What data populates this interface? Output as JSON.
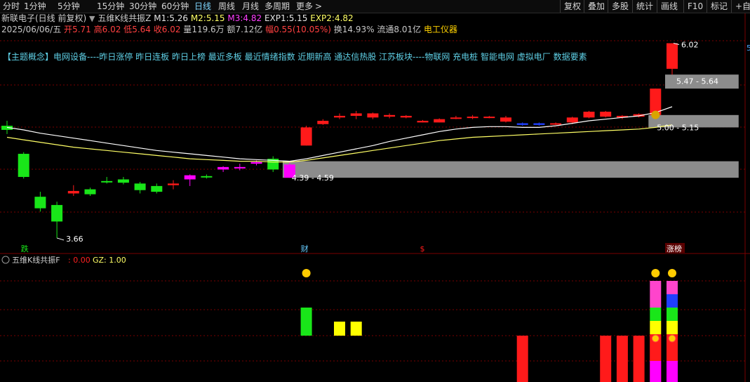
{
  "toolbar": {
    "periods": [
      "分时",
      "1分钟",
      "5分钟",
      "15分钟",
      "30分钟",
      "60分钟",
      "日线",
      "周线",
      "月线",
      "多周期",
      "更多"
    ],
    "active_period": "日线",
    "more_arrow": ">",
    "right_buttons": [
      "复权",
      "叠加",
      "多股",
      "统计",
      "画线",
      "F10",
      "标记",
      "+自选"
    ]
  },
  "info_line1": {
    "stock": "新联电子(日线 前复权)",
    "indicator": "五维K线共振Z",
    "m1_label": "M1:",
    "m1_value": "5.26",
    "m2_label": "M2:",
    "m2_value": "5.15",
    "m3_label": "M3:",
    "m3_value": "4.82",
    "exp1_label": "EXP1:",
    "exp1_value": "5.15",
    "exp2_label": "EXP2:",
    "exp2_value": "4.82"
  },
  "info_line2": {
    "date": "2025/06/06/五",
    "open_label": "开",
    "open": "5.71",
    "high_label": "高",
    "high": "6.02",
    "low_label": "低",
    "low": "5.64",
    "close_label": "收",
    "close": "6.02",
    "vol_label": "量",
    "vol": "119.6万",
    "amt_label": "额",
    "amt": "7.12亿",
    "chg_label": "幅",
    "chg": "0.55(10.05%)",
    "turn_label": "换",
    "turn": "14.93%",
    "float_label": "流通",
    "float": "8.01亿",
    "sector": "电工仪器"
  },
  "concepts": "【主题概念】电网设备----昨日涨停 昨日连板 昨日上榜 最近多板 最近情绪指数 近期新高 通达信热股 江苏板块----物联网 充电桩 智能电网 虚拟电厂 数据要素",
  "annotations": {
    "high_price": "6.02",
    "low_price": "3.66",
    "zone_top": "5.47 - 5.64",
    "zone_mid": "5.00 - 5.15",
    "zone_low": "4.39 - 4.59",
    "right_edge_tag": "5"
  },
  "markers": {
    "die": "跌",
    "cai": "财",
    "dollar": "$",
    "zhangbang": "涨榜"
  },
  "sub_panel": {
    "title": "五维K线共振F",
    "f_sep": ":",
    "f_value": "0.00",
    "gz_label": "GZ:",
    "gz_value": "1.00"
  },
  "colors": {
    "up": "#ff1a1a",
    "down": "#19e619",
    "magenta": "#ff00ff",
    "blue": "#1f3fff",
    "yellow": "#ffff00",
    "zone": "#8c8c8c",
    "ma_line": "#ffffff",
    "ma_line2": "#ffff66",
    "cyan_text": "#5fd0e6",
    "grid": "#7a0000"
  },
  "candles": [
    {
      "o": 5.02,
      "h": 5.08,
      "l": 4.92,
      "c": 4.97,
      "t": "down"
    },
    {
      "o": 4.68,
      "h": 4.7,
      "l": 4.38,
      "c": 4.4,
      "t": "down"
    },
    {
      "o": 4.16,
      "h": 4.22,
      "l": 3.98,
      "c": 4.02,
      "t": "down"
    },
    {
      "o": 4.06,
      "h": 4.1,
      "l": 3.66,
      "c": 3.86,
      "t": "down"
    },
    {
      "o": 4.2,
      "h": 4.3,
      "l": 4.17,
      "c": 4.23,
      "t": "up"
    },
    {
      "o": 4.25,
      "h": 4.27,
      "l": 4.17,
      "c": 4.19,
      "t": "down"
    },
    {
      "o": 4.35,
      "h": 4.4,
      "l": 4.32,
      "c": 4.34,
      "t": "down"
    },
    {
      "o": 4.37,
      "h": 4.4,
      "l": 4.31,
      "c": 4.33,
      "t": "down"
    },
    {
      "o": 4.32,
      "h": 4.34,
      "l": 4.2,
      "c": 4.24,
      "t": "down"
    },
    {
      "o": 4.29,
      "h": 4.32,
      "l": 4.2,
      "c": 4.22,
      "t": "down"
    },
    {
      "o": 4.3,
      "h": 4.36,
      "l": 4.25,
      "c": 4.32,
      "t": "up"
    },
    {
      "o": 4.37,
      "h": 4.43,
      "l": 4.29,
      "c": 4.42,
      "t": "mag"
    },
    {
      "o": 4.41,
      "h": 4.43,
      "l": 4.38,
      "c": 4.4,
      "t": "down"
    },
    {
      "o": 4.49,
      "h": 4.53,
      "l": 4.46,
      "c": 4.52,
      "t": "mag"
    },
    {
      "o": 4.51,
      "h": 4.56,
      "l": 4.48,
      "c": 4.52,
      "t": "mag"
    },
    {
      "o": 4.56,
      "h": 4.6,
      "l": 4.54,
      "c": 4.58,
      "t": "mag"
    },
    {
      "o": 4.62,
      "h": 4.65,
      "l": 4.46,
      "c": 4.49,
      "t": "down"
    },
    {
      "o": 4.39,
      "h": 4.59,
      "l": 4.39,
      "c": 4.55,
      "t": "mag"
    },
    {
      "o": 4.78,
      "h": 5.02,
      "l": 4.78,
      "c": 5.0,
      "t": "up"
    },
    {
      "o": 5.04,
      "h": 5.1,
      "l": 5.03,
      "c": 5.08,
      "t": "up"
    },
    {
      "o": 5.12,
      "h": 5.17,
      "l": 5.1,
      "c": 5.14,
      "t": "up"
    },
    {
      "o": 5.14,
      "h": 5.2,
      "l": 5.1,
      "c": 5.17,
      "t": "up"
    },
    {
      "o": 5.12,
      "h": 5.18,
      "l": 5.1,
      "c": 5.17,
      "t": "up"
    },
    {
      "o": 5.13,
      "h": 5.17,
      "l": 5.11,
      "c": 5.15,
      "t": "up"
    },
    {
      "o": 5.12,
      "h": 5.15,
      "l": 5.11,
      "c": 5.14,
      "t": "up"
    },
    {
      "o": 5.06,
      "h": 5.09,
      "l": 5.06,
      "c": 5.08,
      "t": "up"
    },
    {
      "o": 5.06,
      "h": 5.11,
      "l": 5.06,
      "c": 5.1,
      "t": "up"
    },
    {
      "o": 5.11,
      "h": 5.14,
      "l": 5.1,
      "c": 5.12,
      "t": "up"
    },
    {
      "o": 5.12,
      "h": 5.15,
      "l": 5.1,
      "c": 5.13,
      "t": "up"
    },
    {
      "o": 5.12,
      "h": 5.14,
      "l": 5.11,
      "c": 5.13,
      "t": "up"
    },
    {
      "o": 5.07,
      "h": 5.14,
      "l": 5.06,
      "c": 5.12,
      "t": "up"
    },
    {
      "o": 5.05,
      "h": 5.06,
      "l": 5.02,
      "c": 5.03,
      "t": "blue"
    },
    {
      "o": 5.05,
      "h": 5.06,
      "l": 5.02,
      "c": 5.03,
      "t": "blue"
    },
    {
      "o": 5.05,
      "h": 5.06,
      "l": 5.03,
      "c": 5.05,
      "t": "up"
    },
    {
      "o": 5.06,
      "h": 5.13,
      "l": 5.04,
      "c": 5.12,
      "t": "up"
    },
    {
      "o": 5.12,
      "h": 5.2,
      "l": 5.11,
      "c": 5.19,
      "t": "up"
    },
    {
      "o": 5.13,
      "h": 5.2,
      "l": 5.12,
      "c": 5.19,
      "t": "up"
    },
    {
      "o": 5.12,
      "h": 5.15,
      "l": 5.1,
      "c": 5.14,
      "t": "up"
    },
    {
      "o": 5.13,
      "h": 5.17,
      "l": 5.12,
      "c": 5.16,
      "t": "up"
    },
    {
      "o": 5.15,
      "h": 5.47,
      "l": 5.15,
      "c": 5.47,
      "t": "up"
    },
    {
      "o": 5.71,
      "h": 6.02,
      "l": 5.64,
      "c": 6.02,
      "t": "up"
    }
  ],
  "ma_slow": [
    5.0,
    4.97,
    4.93,
    4.9,
    4.87,
    4.84,
    4.81,
    4.78,
    4.75,
    4.72,
    4.7,
    4.68,
    4.66,
    4.64,
    4.62,
    4.61,
    4.6,
    4.59,
    4.62,
    4.66,
    4.7,
    4.74,
    4.78,
    4.83,
    4.87,
    4.91,
    4.95,
    4.98,
    5.0,
    5.01,
    5.01,
    5.0,
    5.0,
    5.02,
    5.05,
    5.08,
    5.1,
    5.12,
    5.14,
    5.18,
    5.25
  ],
  "ma_long": [
    4.88,
    4.85,
    4.82,
    4.79,
    4.76,
    4.74,
    4.72,
    4.7,
    4.68,
    4.66,
    4.64,
    4.62,
    4.61,
    4.6,
    4.59,
    4.59,
    4.58,
    4.58,
    4.6,
    4.63,
    4.66,
    4.69,
    4.72,
    4.75,
    4.78,
    4.81,
    4.84,
    4.86,
    4.88,
    4.89,
    4.9,
    4.91,
    4.92,
    4.93,
    4.94,
    4.95,
    4.96,
    4.97,
    4.98,
    5.0,
    5.03
  ],
  "sub_bars": [
    {
      "i": 18,
      "color": "#19e619",
      "v": 0.4,
      "top": true
    },
    {
      "i": 20,
      "color": "#ffff00",
      "v": 0.2,
      "top": true
    },
    {
      "i": 21,
      "color": "#ffff00",
      "v": 0.2,
      "top": true
    },
    {
      "i": 31,
      "color": "#ff1a1a",
      "v": 0.65,
      "top": false
    },
    {
      "i": 36,
      "color": "#ff1a1a",
      "v": 0.65,
      "top": false
    },
    {
      "i": 37,
      "color": "#ff1a1a",
      "v": 0.65,
      "top": false
    },
    {
      "i": 38,
      "color": "#ff1a1a",
      "v": 0.65,
      "top": false
    },
    {
      "i": 39,
      "color": "#ff1a1a",
      "v": 0.65,
      "top": false
    }
  ]
}
